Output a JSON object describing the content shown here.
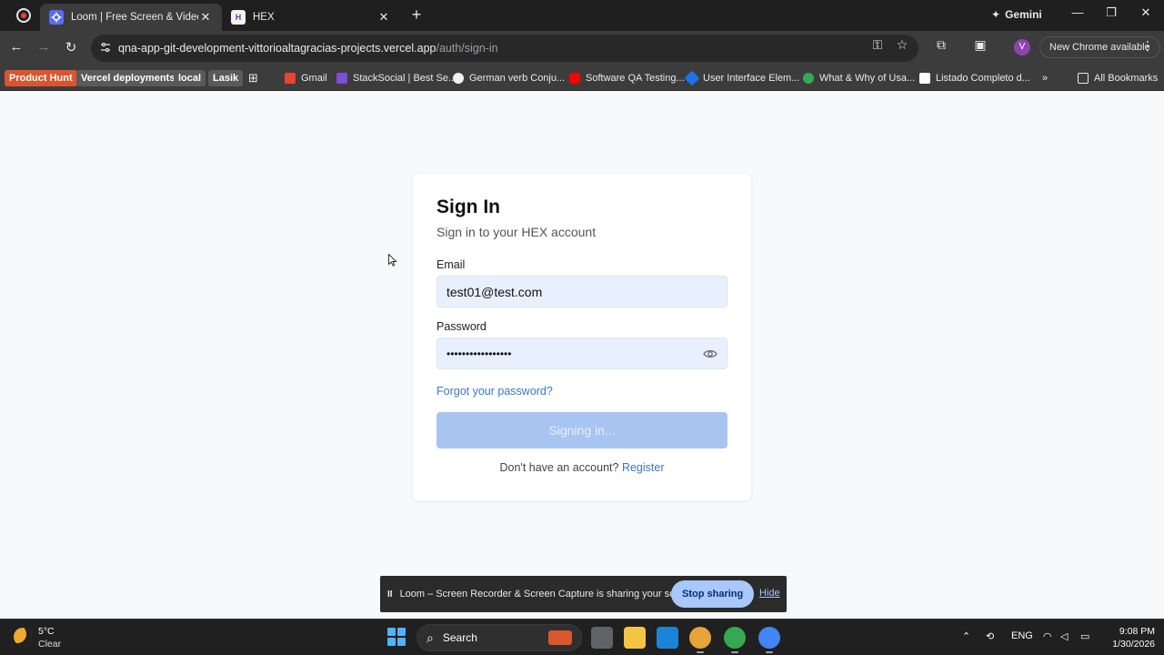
{
  "browser": {
    "tabs": [
      {
        "title": "Loom | Free Screen & Video Re",
        "active": true
      },
      {
        "title": "HEX",
        "favicon_text": "H",
        "active": false
      }
    ],
    "gemini_label": "Gemini",
    "url_host": "qna-app-git-development-vittorioaltagracias-projects.vercel.app",
    "url_path": "/auth/sign-in",
    "profile_initial": "V",
    "update_label": "New Chrome available"
  },
  "bookmarks": {
    "items": [
      "Product Hunt",
      "Vercel deployments",
      "local",
      "Lasik",
      "Gmail",
      "StackSocial | Best Se...",
      "German verb Conju...",
      "Software QA Testing...",
      "User Interface Elem...",
      "What & Why of Usa...",
      "Listado Completo d..."
    ],
    "all_bookmarks": "All Bookmarks"
  },
  "signin": {
    "title": "Sign In",
    "subtitle": "Sign in to your HEX account",
    "email_label": "Email",
    "email_value": "test01@test.com",
    "password_label": "Password",
    "password_value": "•••••••••••••••••",
    "forgot_link": "Forgot your password?",
    "submit_label": "Signing in...",
    "register_prompt": "Don't have an account?",
    "register_link": "Register"
  },
  "loom": {
    "pause_glyph": "II",
    "message": "Loom – Screen Recorder & Screen Capture is sharing your screen.",
    "stop_label": "Stop sharing",
    "hide_label": "Hide"
  },
  "taskbar": {
    "temperature": "5°C",
    "condition": "Clear",
    "search_label": "Search",
    "language": "ENG",
    "time": "9:08 PM",
    "date": "1/30/2026"
  },
  "colors": {
    "accent_link": "#3b76c6",
    "button_disabled": "#a8c4f0",
    "autofill_bg": "#e8f0fe",
    "loom_stop": "#a8c7fa"
  }
}
